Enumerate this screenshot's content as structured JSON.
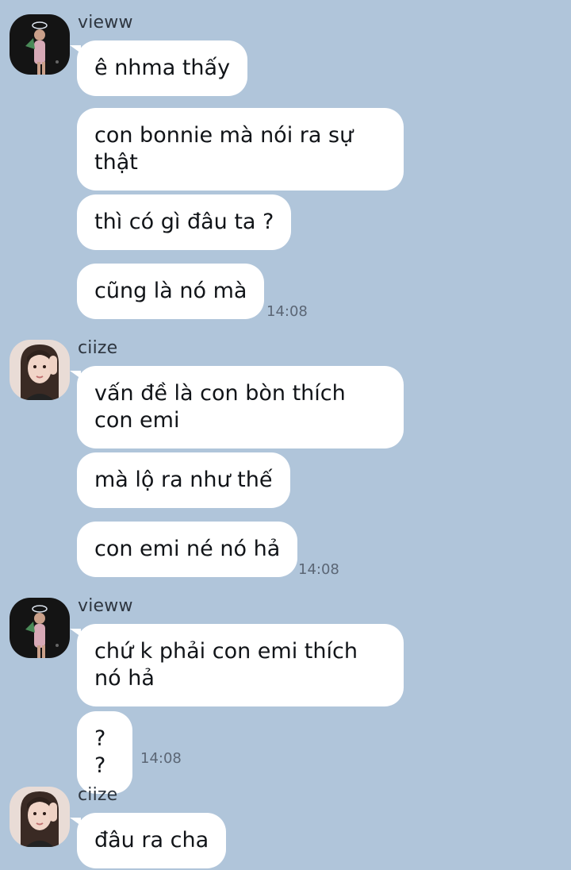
{
  "colors": {
    "background": "#b0c5da",
    "bubble": "#ffffff",
    "text": "#111418",
    "meta": "#5b6675"
  },
  "messages": [
    {
      "sender": "vieww",
      "avatar_icon": "avatar-vieww-icon",
      "bubbles": [
        "ê nhma thấy",
        "con bonnie mà nói ra sự thật",
        "thì có gì đâu ta ?",
        "cũng là nó mà"
      ],
      "time": "14:08"
    },
    {
      "sender": "ciize",
      "avatar_icon": "avatar-ciize-icon",
      "bubbles": [
        "vấn đề là con bòn thích con emi",
        "mà lộ ra như thế",
        "con emi né nó hả"
      ],
      "time": "14:08"
    },
    {
      "sender": "vieww",
      "avatar_icon": "avatar-vieww-icon",
      "bubbles": [
        "chứ k phải con emi thích nó hả",
        "??"
      ],
      "time": "14:08"
    },
    {
      "sender": "ciize",
      "avatar_icon": "avatar-ciize-icon",
      "bubbles": [
        "đâu ra cha"
      ],
      "time": ""
    }
  ]
}
